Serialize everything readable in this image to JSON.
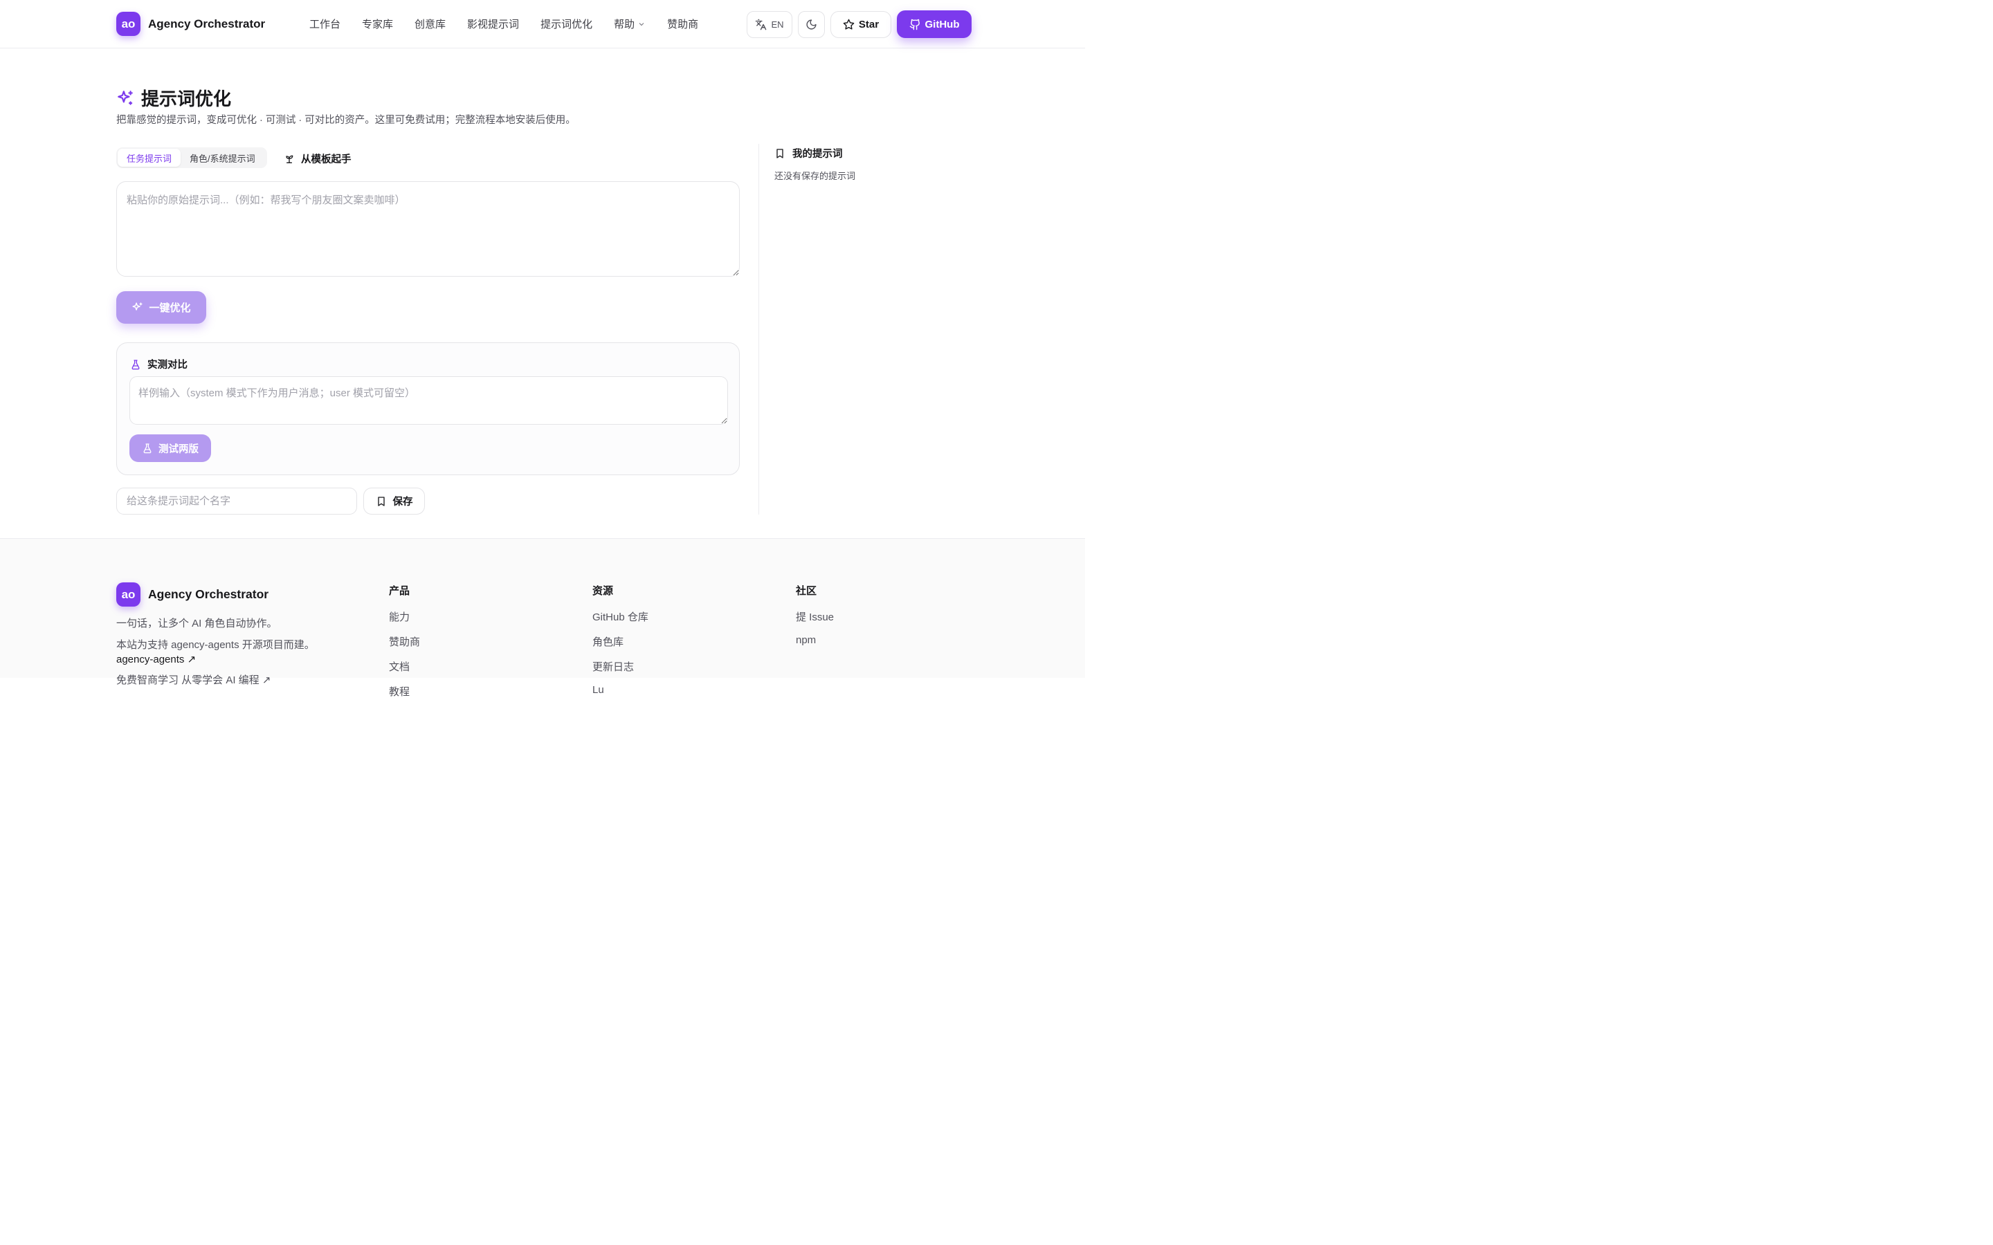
{
  "header": {
    "logo_text": "ao",
    "brand_name": "Agency Orchestrator",
    "nav": [
      "工作台",
      "专家库",
      "创意库",
      "影视提示词",
      "提示词优化",
      "帮助",
      "赞助商"
    ],
    "lang_label": "EN",
    "star_label": "Star",
    "github_label": "GitHub"
  },
  "main": {
    "title": "提示词优化",
    "subtitle": "把靠感觉的提示词，变成可优化 · 可测试 · 可对比的资产。这里可免费试用；完整流程本地安装后使用。",
    "modes": [
      "任务提示词",
      "角色/系统提示词"
    ],
    "from_template": "从模板起手",
    "prompt_placeholder": "粘贴你的原始提示词...（例如：帮我写个朋友圈文案卖咖啡）",
    "optimize_label": "一键优化",
    "compare": {
      "title": "实测对比",
      "sample_placeholder": "样例输入（system 模式下作为用户消息；user 模式可留空）",
      "test_label": "测试两版"
    },
    "name_placeholder": "给这条提示词起个名字",
    "save_label": "保存"
  },
  "sidebar": {
    "title": "我的提示词",
    "empty": "还没有保存的提示词"
  },
  "footer": {
    "logo_text": "ao",
    "brand_name": "Agency Orchestrator",
    "tagline": "一句话，让多个 AI 角色自动协作。",
    "about": "本站为支持 agency-agents 开源项目而建。",
    "about_link": "agency-agents ↗",
    "cut_line": "免费智商学习 从零学会 AI 编程 ↗",
    "columns": [
      {
        "title": "产品",
        "links": [
          "能力",
          "赞助商",
          "文档",
          "教程"
        ]
      },
      {
        "title": "资源",
        "links": [
          "GitHub 仓库",
          "角色库",
          "更新日志",
          "Lu"
        ]
      },
      {
        "title": "社区",
        "links": [
          "提 Issue",
          "npm"
        ]
      }
    ]
  },
  "colors": {
    "accent": "#7c3aed",
    "accent_soft": "#b49af0"
  }
}
